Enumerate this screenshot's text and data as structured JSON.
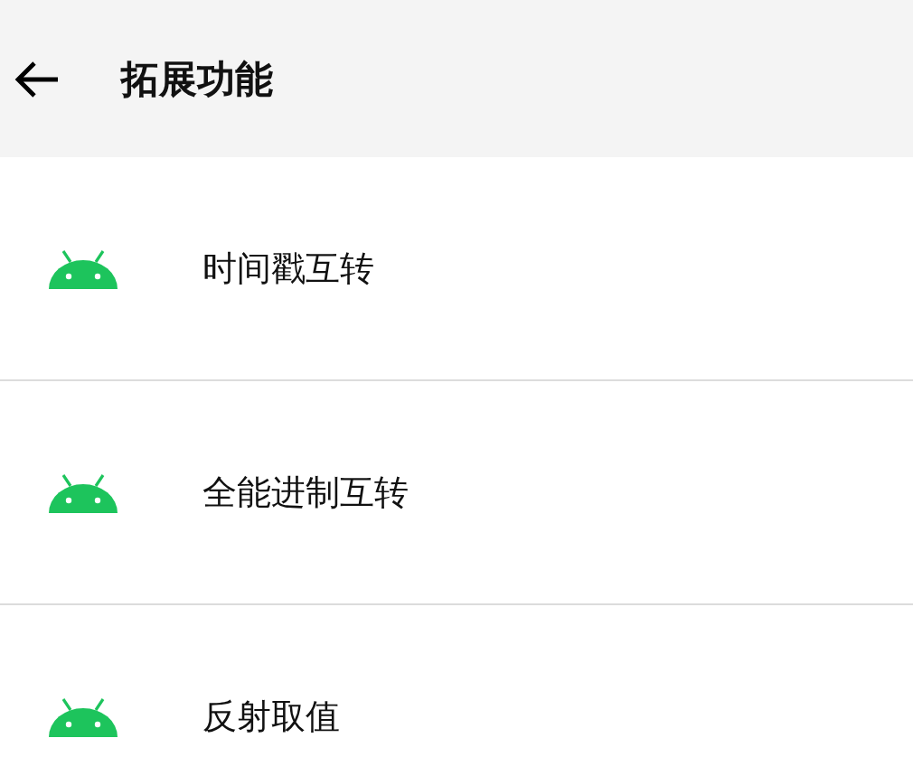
{
  "header": {
    "title": "拓展功能"
  },
  "items": [
    {
      "label": "时间戳互转"
    },
    {
      "label": "全能进制互转"
    },
    {
      "label": "反射取值"
    }
  ]
}
